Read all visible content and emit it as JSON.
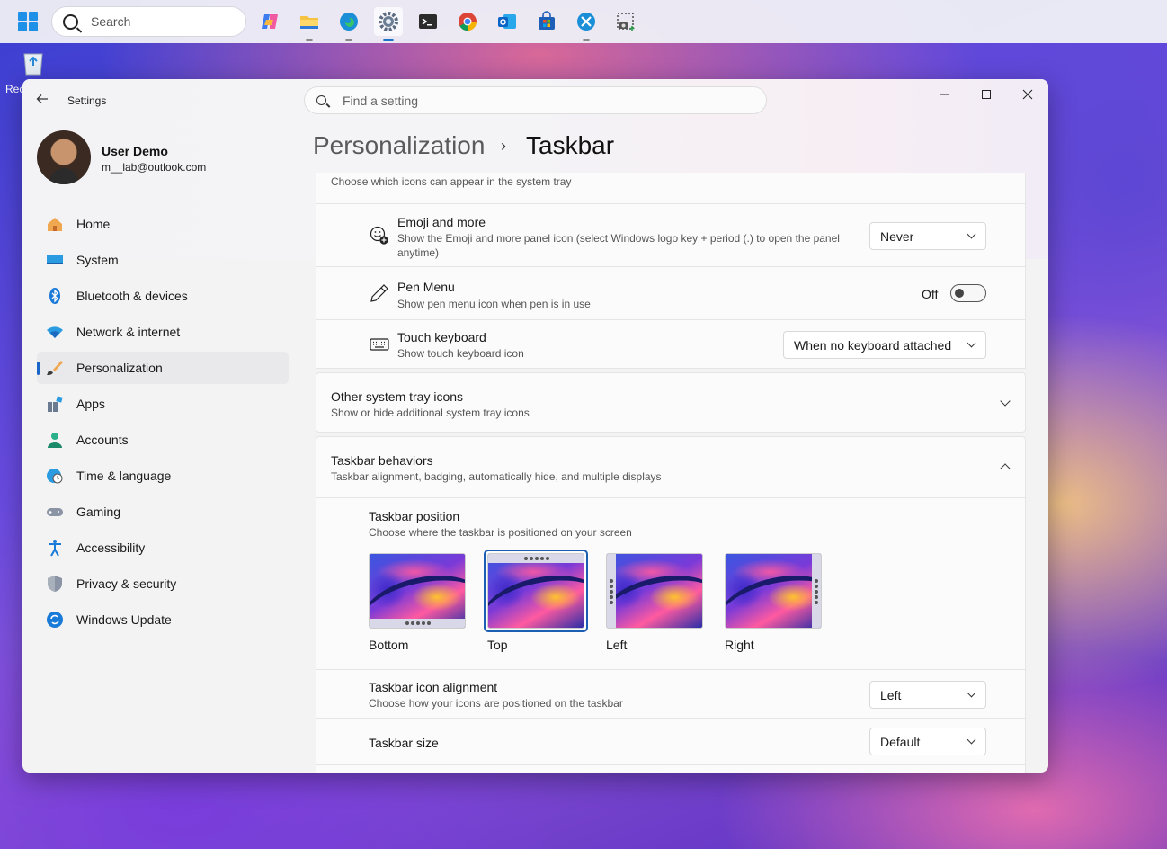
{
  "taskbar": {
    "search_placeholder": "Search",
    "apps": [
      {
        "name": "copilot-icon"
      },
      {
        "name": "file-explorer-icon"
      },
      {
        "name": "edge-icon"
      },
      {
        "name": "settings-icon",
        "active": true
      },
      {
        "name": "terminal-icon"
      },
      {
        "name": "chrome-icon"
      },
      {
        "name": "outlook-icon"
      },
      {
        "name": "store-icon"
      },
      {
        "name": "snipping-tool-icon"
      },
      {
        "name": "snapshot-icon"
      }
    ]
  },
  "desktop": {
    "recycle_label": "Rec"
  },
  "window": {
    "title": "Settings",
    "search_placeholder": "Find a setting",
    "controls": {
      "minimize": "—",
      "maximize": "☐",
      "close": "✕"
    }
  },
  "user": {
    "name": "User Demo",
    "email": "m__lab@outlook.com"
  },
  "nav": {
    "items": [
      {
        "label": "Home",
        "icon": "home-icon"
      },
      {
        "label": "System",
        "icon": "system-icon"
      },
      {
        "label": "Bluetooth & devices",
        "icon": "bluetooth-icon"
      },
      {
        "label": "Network & internet",
        "icon": "wifi-icon"
      },
      {
        "label": "Personalization",
        "icon": "brush-icon",
        "selected": true
      },
      {
        "label": "Apps",
        "icon": "apps-icon"
      },
      {
        "label": "Accounts",
        "icon": "accounts-icon"
      },
      {
        "label": "Time & language",
        "icon": "globe-clock-icon"
      },
      {
        "label": "Gaming",
        "icon": "gamepad-icon"
      },
      {
        "label": "Accessibility",
        "icon": "accessibility-icon"
      },
      {
        "label": "Privacy & security",
        "icon": "shield-icon"
      },
      {
        "label": "Windows Update",
        "icon": "update-icon"
      }
    ]
  },
  "breadcrumb": {
    "parent": "Personalization",
    "separator": "›",
    "current": "Taskbar"
  },
  "tray": {
    "header_sub": "Choose which icons can appear in the system tray",
    "emoji": {
      "title": "Emoji and more",
      "sub1": "Show the Emoji and more panel icon (select Windows logo key + period (.) to open the panel",
      "sub2": "anytime)",
      "value": "Never"
    },
    "pen": {
      "title": "Pen Menu",
      "sub": "Show pen menu icon when pen is in use",
      "state_label": "Off",
      "on": false
    },
    "touch": {
      "title": "Touch keyboard",
      "sub": "Show touch keyboard icon",
      "value": "When no keyboard attached"
    }
  },
  "other_tray": {
    "title": "Other system tray icons",
    "sub": "Show or hide additional system tray icons"
  },
  "behaviors": {
    "title": "Taskbar behaviors",
    "sub": "Taskbar alignment, badging, automatically hide, and multiple displays",
    "position": {
      "title": "Taskbar position",
      "sub": "Choose where the taskbar is positioned on your screen",
      "options": [
        {
          "label": "Bottom",
          "selected": false
        },
        {
          "label": "Top",
          "selected": true
        },
        {
          "label": "Left",
          "selected": false
        },
        {
          "label": "Right",
          "selected": false
        }
      ]
    },
    "alignment": {
      "title": "Taskbar icon alignment",
      "sub": "Choose how your icons are positioned on the taskbar",
      "value": "Left"
    },
    "size": {
      "title": "Taskbar size",
      "value": "Default"
    }
  }
}
